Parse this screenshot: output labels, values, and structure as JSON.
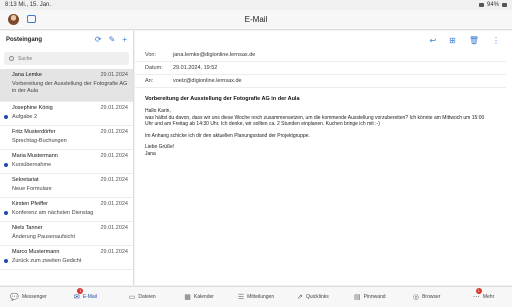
{
  "statusbar": {
    "time": "8:13",
    "date": "Mi., 15. Jan.",
    "battery": "94%"
  },
  "app": {
    "title": "E-Mail"
  },
  "left": {
    "folder": "Posteingang",
    "search_placeholder": "Suche",
    "mails": [
      {
        "from": "Jana Lemke",
        "date": "29.01.2024",
        "subject": "Vorbereitung der Ausstellung der Fotografie AG in der Aula",
        "unread": false,
        "selected": true
      },
      {
        "from": "Josephine König",
        "date": "29.01.2024",
        "subject": "Aufgabe 2",
        "unread": true
      },
      {
        "from": "Fritz Musterdörfer",
        "date": "29.01.2024",
        "subject": "Sprechtag-Buchungen",
        "unread": false
      },
      {
        "from": "Maria Mustermann",
        "date": "29.01.2024",
        "subject": "Kursübernahme",
        "unread": true
      },
      {
        "from": "Sekretariat",
        "date": "29.01.2024",
        "subject": "Neue Formulare",
        "unread": false
      },
      {
        "from": "Kirsten Pfeiffer",
        "date": "29.01.2024",
        "subject": "Konferenz am nächsten Dienstag",
        "unread": true
      },
      {
        "from": "Niels Tanner",
        "date": "29.01.2024",
        "subject": "Änderung Pausenaufsicht",
        "unread": false
      },
      {
        "from": "Marco Mustermann",
        "date": "29.01.2024",
        "subject": "Zurück zum zweiten Gedicht",
        "unread": true
      }
    ]
  },
  "mail": {
    "from_label": "Von:",
    "from": "jana.lemke@digionline.lernsax.de",
    "date_label": "Datum:",
    "date": "29.01.2024, 19:52",
    "to_label": "An:",
    "to": "voelz@digionline.lernsax.de",
    "subject": "Vorbereitung der Ausstellung der Fotografie AG in der Aula",
    "body": [
      "Hallo Karin,",
      "was hältst du davon, dass wir uns diese Woche noch zusammensetzen, um die kommende Ausstellung vorzubereiten? Ich könnte am Mittwoch um 15:00 Uhr und am Freitag ab 14:30 Uhr. Ich denke, wir sollten ca. 2 Stunden einplanen. Kuchen bringe ich mit :-)",
      "Im Anhang schicke ich dir den aktuellen Planungsstand der Projektgruppe.",
      "Liebe Grüße!",
      "Jana"
    ]
  },
  "nav": [
    {
      "label": "Messenger",
      "icon": "chat-icon",
      "active": false
    },
    {
      "label": "E-Mail",
      "icon": "mail-icon",
      "active": true,
      "badge": "1"
    },
    {
      "label": "Dateien",
      "icon": "folder-icon",
      "active": false
    },
    {
      "label": "Kalender",
      "icon": "calendar-icon",
      "active": false
    },
    {
      "label": "Mitteilungen",
      "icon": "notification-icon",
      "active": false
    },
    {
      "label": "Quicklinks",
      "icon": "link-icon",
      "active": false
    },
    {
      "label": "Pinnwand",
      "icon": "board-icon",
      "active": false
    },
    {
      "label": "Browser",
      "icon": "globe-icon",
      "active": false
    },
    {
      "label": "Mehr",
      "icon": "more-icon",
      "active": false,
      "badge": "1"
    }
  ]
}
